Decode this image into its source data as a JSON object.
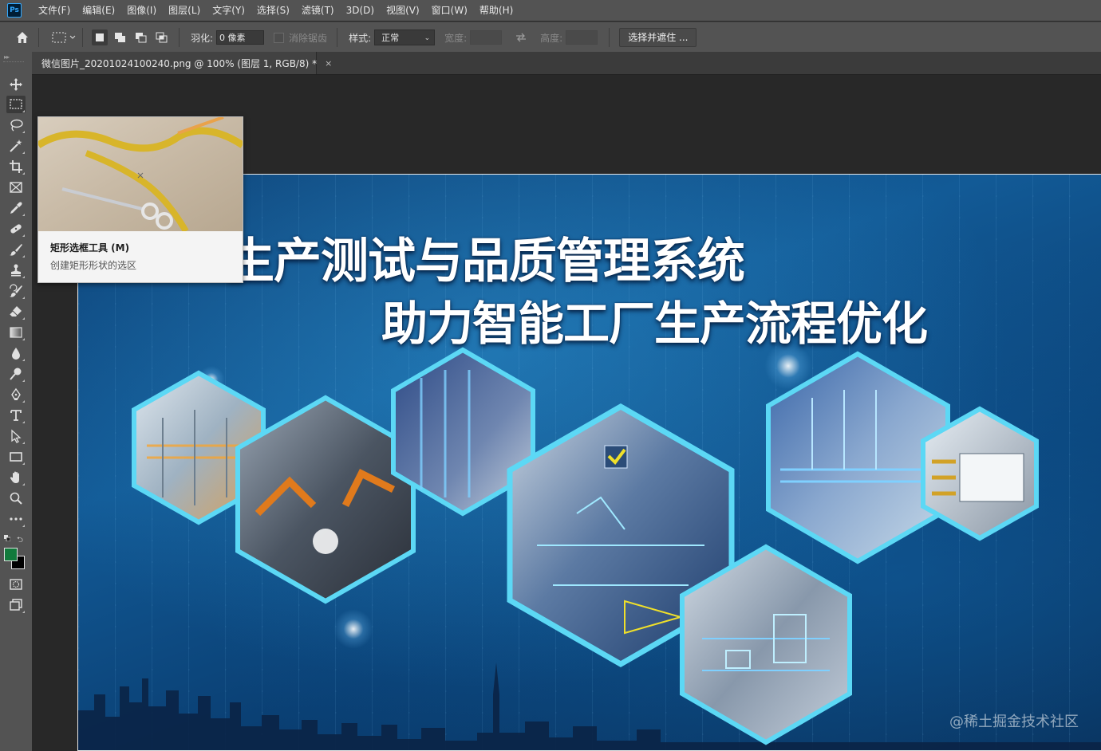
{
  "menubar": {
    "app_logo": "Ps",
    "items": [
      "文件(F)",
      "编辑(E)",
      "图像(I)",
      "图层(L)",
      "文字(Y)",
      "选择(S)",
      "滤镜(T)",
      "3D(D)",
      "视图(V)",
      "窗口(W)",
      "帮助(H)"
    ]
  },
  "options": {
    "feather_label": "羽化:",
    "feather_value": "0 像素",
    "antialias_label": "消除锯齿",
    "style_label": "样式:",
    "style_value": "正常",
    "width_label": "宽度:",
    "height_label": "高度:",
    "select_mask_label": "选择并遮住 ..."
  },
  "document": {
    "tab_title": "微信图片_20201024100240.png @ 100% (图层 1, RGB/8) *",
    "close_glyph": "×"
  },
  "tools": [
    {
      "name": "move-tool",
      "icon": "move-icon"
    },
    {
      "name": "rectangular-marquee-tool",
      "icon": "marquee-icon",
      "active": true
    },
    {
      "name": "lasso-tool",
      "icon": "lasso-icon"
    },
    {
      "name": "magic-wand-tool",
      "icon": "wand-icon"
    },
    {
      "name": "crop-tool",
      "icon": "crop-icon"
    },
    {
      "name": "frame-tool",
      "icon": "frame-icon"
    },
    {
      "name": "eyedropper-tool",
      "icon": "eyedropper-icon"
    },
    {
      "name": "healing-brush-tool",
      "icon": "bandage-icon"
    },
    {
      "name": "brush-tool",
      "icon": "brush-icon"
    },
    {
      "name": "clone-stamp-tool",
      "icon": "stamp-icon"
    },
    {
      "name": "history-brush-tool",
      "icon": "history-brush-icon"
    },
    {
      "name": "eraser-tool",
      "icon": "eraser-icon"
    },
    {
      "name": "gradient-tool",
      "icon": "gradient-icon"
    },
    {
      "name": "blur-tool",
      "icon": "drop-icon"
    },
    {
      "name": "dodge-tool",
      "icon": "dodge-icon"
    },
    {
      "name": "pen-tool",
      "icon": "pen-icon"
    },
    {
      "name": "type-tool",
      "icon": "type-icon"
    },
    {
      "name": "path-selection-tool",
      "icon": "arrow-icon"
    },
    {
      "name": "rectangle-tool",
      "icon": "rectangle-icon"
    },
    {
      "name": "hand-tool",
      "icon": "hand-icon"
    },
    {
      "name": "zoom-tool",
      "icon": "zoom-icon"
    },
    {
      "name": "more-tools",
      "icon": "ellipsis-icon"
    }
  ],
  "colors": {
    "foreground": "#127a3c",
    "background": "#000000",
    "accent": "#31a8ff"
  },
  "tooltip": {
    "title": "矩形选框工具 (M)",
    "description": "创建矩形形状的选区"
  },
  "artwork": {
    "headline_line1": "生产测试与品质管理系统",
    "headline_line2": "助力智能工厂生产流程优化",
    "watermark": "@稀土掘金技术社区"
  }
}
